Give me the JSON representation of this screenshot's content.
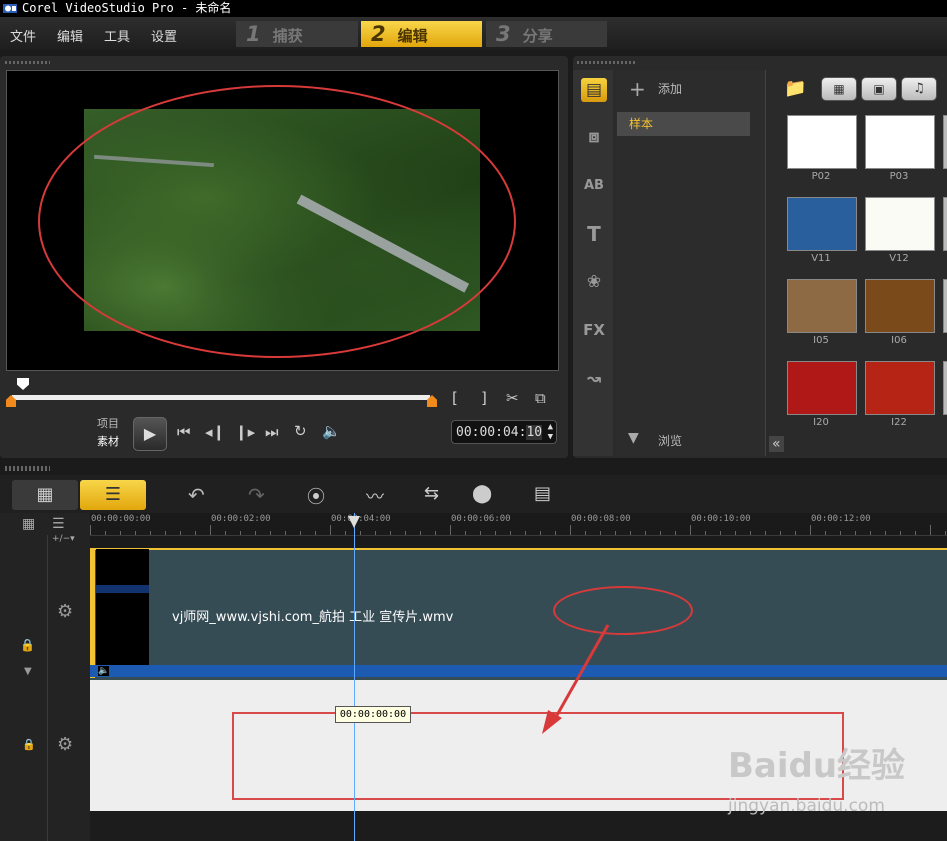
{
  "window": {
    "title": "Corel VideoStudio Pro - 未命名"
  },
  "menu": {
    "items": [
      "文件",
      "编辑",
      "工具",
      "设置"
    ]
  },
  "steps": [
    {
      "num": "1",
      "label": "捕获"
    },
    {
      "num": "2",
      "label": "编辑"
    },
    {
      "num": "3",
      "label": "分享"
    }
  ],
  "player": {
    "mode_project": "项目",
    "mode_clip": "素材",
    "timecode": "00:00:04:",
    "timecode_frames": "10",
    "mark_in": "[",
    "mark_out": "]"
  },
  "library": {
    "add_label": "添加",
    "folder_selected": "样本",
    "browse_label": "浏览",
    "side_icons": [
      "media-icon",
      "transition-icon",
      "ab-icon",
      "title-icon",
      "graphics-icon",
      "fx-icon",
      "path-icon"
    ],
    "thumbnails": [
      {
        "label": "P02",
        "bg": "#ffffff"
      },
      {
        "label": "P03",
        "bg": "#ffffff"
      },
      {
        "label": "V11",
        "bg": "#2a5f9e"
      },
      {
        "label": "V12",
        "bg": "#fbfbf6"
      },
      {
        "label": "I05",
        "bg": "#8e6a44"
      },
      {
        "label": "I06",
        "bg": "#7a4a1a"
      },
      {
        "label": "I20",
        "bg": "#b01818"
      },
      {
        "label": "I22",
        "bg": "#b52415"
      }
    ],
    "collapse_label": "«"
  },
  "timeline": {
    "ruler_labels": [
      "00:00:00:00",
      "00:00:02:00",
      "00:00:04:00",
      "00:00:06:00",
      "00:00:08:00",
      "00:00:10:00",
      "00:00:12:00"
    ],
    "clip_name": "vj师网_www.vjshi.com_航拍 工业 宣传片.wmv",
    "playhead_tooltip": "00:00:00:00"
  },
  "watermark": {
    "text": "Baidu经验",
    "url": "jingyan.baidu.com"
  },
  "colors": {
    "accent": "#f1c232",
    "annotation_red": "#d83a3a",
    "clip_bg": "#364c55"
  }
}
